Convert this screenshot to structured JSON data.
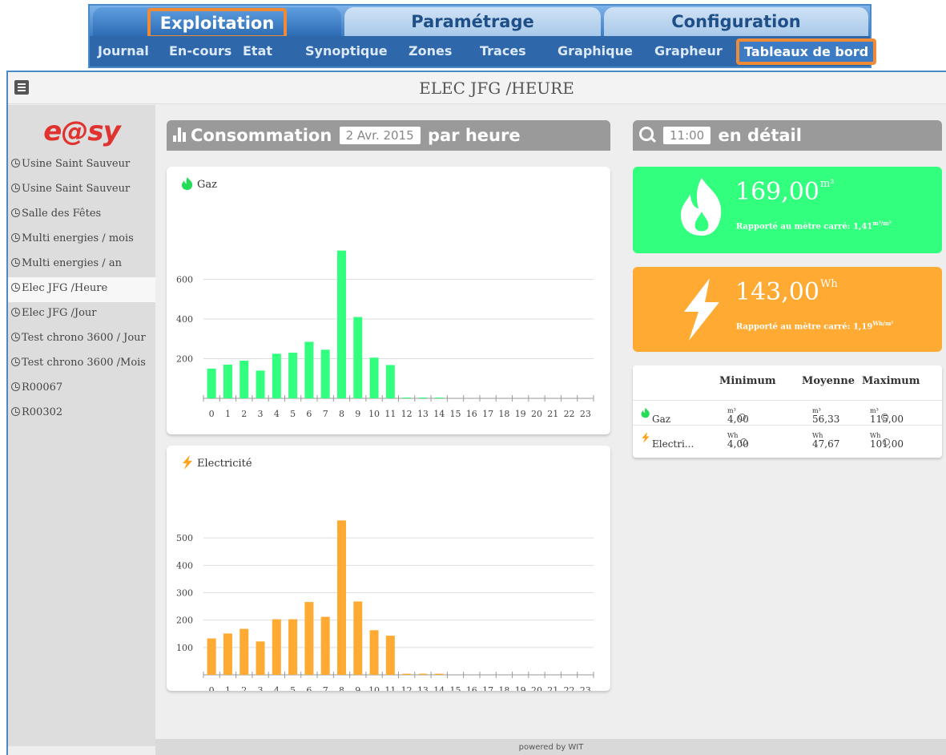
{
  "nav": {
    "main_tabs": [
      "Exploitation",
      "Paramétrage",
      "Configuration"
    ],
    "sub_items": [
      "Journal",
      "En-cours",
      "Etat",
      "Synoptique",
      "Zones",
      "Traces",
      "Graphique",
      "Grapheur",
      "Tableaux de bord"
    ],
    "active_main": "Exploitation",
    "active_sub": "Tableaux de bord",
    "highlight_color": "#ef8a36"
  },
  "app": {
    "title": "ELEC JFG /HEURE",
    "menu_icon": "hamburger-icon",
    "footer": "powered by WIT"
  },
  "sidebar": {
    "logo_text": "e@sy",
    "items": [
      {
        "label": "Usine Saint Sauveur"
      },
      {
        "label": "Usine Saint Sauveur"
      },
      {
        "label": "Salle des Fêtes"
      },
      {
        "label": "Multi energies / mois"
      },
      {
        "label": "Multi energies / an"
      },
      {
        "label": "Elec JFG /Heure"
      },
      {
        "label": "Elec JFG /Jour"
      },
      {
        "label": "Test chrono 3600 / Jour"
      },
      {
        "label": "Test chrono 3600 /Mois"
      },
      {
        "label": "R00067"
      },
      {
        "label": "R00302"
      }
    ],
    "active_index": 5
  },
  "left_panel": {
    "title_prefix": "Consommation",
    "date": "2 Avr. 2015",
    "title_suffix": "par heure"
  },
  "right_panel": {
    "hour": "11:00",
    "title_suffix": "en détail"
  },
  "tiles": {
    "gaz": {
      "value": "169,00",
      "unit": "m³",
      "sub_prefix": "Rapporté au mètre carré: ",
      "sub_value": "1,41",
      "sub_unit": "m³/m²",
      "color": "#33ff7e"
    },
    "elec": {
      "value": "143,00",
      "unit": "Wh",
      "sub_prefix": "Rapporté au mètre carré: ",
      "sub_value": "1,19",
      "sub_unit": "Wh/m²",
      "color": "#ffaa33"
    }
  },
  "stats": {
    "headers": [
      "Minimum",
      "Moyenne",
      "Maximum"
    ],
    "rows": [
      {
        "name": "Gaz",
        "min": "4,00",
        "min_unit": "m³",
        "avg": "56,33",
        "avg_unit": "m³",
        "max": "115,00",
        "max_unit": "m³"
      },
      {
        "name": "Electri...",
        "min": "4,00",
        "min_unit": "Wh",
        "avg": "47,67",
        "avg_unit": "Wh",
        "max": "101,00",
        "max_unit": "Wh"
      }
    ]
  },
  "chart_data": [
    {
      "type": "bar",
      "title": "Gaz",
      "color": "#33ff7e",
      "categories": [
        "0",
        "1",
        "2",
        "3",
        "4",
        "5",
        "6",
        "7",
        "8",
        "9",
        "10",
        "11",
        "12",
        "13",
        "14",
        "15",
        "16",
        "17",
        "18",
        "19",
        "20",
        "21",
        "22",
        "23"
      ],
      "values": [
        150,
        170,
        190,
        140,
        225,
        230,
        285,
        245,
        745,
        410,
        205,
        168,
        4,
        4,
        4,
        0,
        0,
        0,
        0,
        0,
        0,
        0,
        0,
        0
      ],
      "yticks": [
        200,
        400,
        600
      ],
      "ylim": [
        0,
        800
      ],
      "grid": true,
      "xlabel": "",
      "ylabel": ""
    },
    {
      "type": "bar",
      "title": "Electricité",
      "color": "#ffaa33",
      "categories": [
        "0",
        "1",
        "2",
        "3",
        "4",
        "5",
        "6",
        "7",
        "8",
        "9",
        "10",
        "11",
        "12",
        "13",
        "14",
        "15",
        "16",
        "17",
        "18",
        "19",
        "20",
        "21",
        "22",
        "23"
      ],
      "values": [
        133,
        151,
        168,
        122,
        203,
        203,
        266,
        212,
        564,
        268,
        163,
        143,
        4,
        4,
        4,
        0,
        0,
        0,
        0,
        0,
        0,
        0,
        0,
        0
      ],
      "yticks": [
        100,
        200,
        300,
        400,
        500
      ],
      "ylim": [
        0,
        600
      ],
      "grid": true,
      "xlabel": "",
      "ylabel": ""
    }
  ]
}
